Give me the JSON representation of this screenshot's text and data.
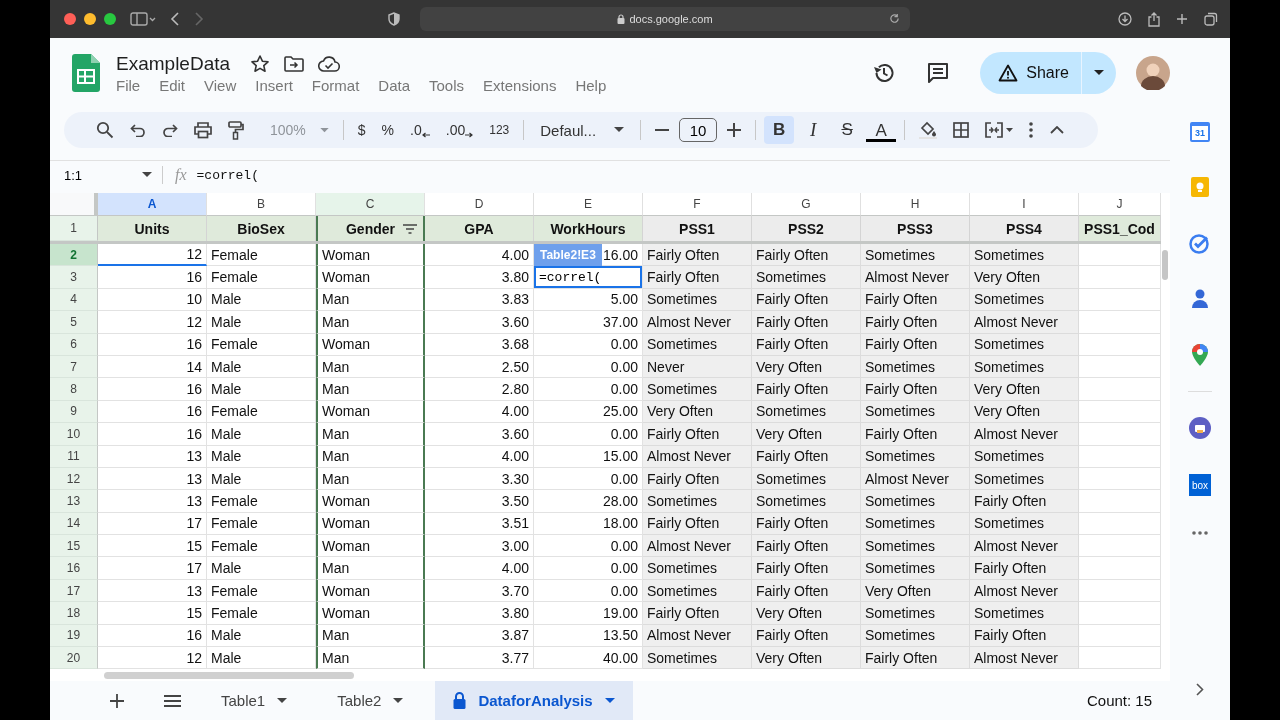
{
  "browser": {
    "url": "docs.google.com"
  },
  "doc": {
    "title": "ExampleData",
    "menus": [
      "File",
      "Edit",
      "View",
      "Insert",
      "Format",
      "Data",
      "Tools",
      "Extensions",
      "Help"
    ],
    "share": "Share"
  },
  "toolbar": {
    "zoom": {
      "label": "100%",
      "disabled": true
    },
    "currency": "$",
    "percent": "%",
    "decrease_decimal": ".0",
    "increase_decimal": ".00",
    "number_format": "123",
    "font": "Defaul...",
    "font_size": "10",
    "bold": {
      "label": "B",
      "on": true
    },
    "italic": {
      "label": "I",
      "on": false
    },
    "strikethrough": {
      "label": "S",
      "on": false
    },
    "text_color": {
      "label": "A"
    }
  },
  "formula_bar": {
    "cell_ref": "1:1",
    "fx": "fx",
    "formula": "=correl("
  },
  "grid": {
    "columns": [
      {
        "letter": "A",
        "header": "Units",
        "kind": "table",
        "selected": true,
        "filter": false
      },
      {
        "letter": "B",
        "header": "BioSex",
        "kind": "table",
        "selected": false,
        "filter": false
      },
      {
        "letter": "C",
        "header": "Gender",
        "kind": "table",
        "selected": false,
        "filter": true
      },
      {
        "letter": "D",
        "header": "GPA",
        "kind": "table",
        "selected": false,
        "filter": false
      },
      {
        "letter": "E",
        "header": "WorkHours",
        "kind": "table",
        "selected": false,
        "filter": false
      },
      {
        "letter": "F",
        "header": "PSS1",
        "kind": "grey",
        "selected": false,
        "filter": false
      },
      {
        "letter": "G",
        "header": "PSS2",
        "kind": "grey",
        "selected": false,
        "filter": false
      },
      {
        "letter": "H",
        "header": "PSS3",
        "kind": "grey",
        "selected": false,
        "filter": false
      },
      {
        "letter": "I",
        "header": "PSS4",
        "kind": "grey",
        "selected": false,
        "filter": false
      },
      {
        "letter": "J",
        "header": "PSS1_Cod",
        "kind": "table",
        "selected": false,
        "filter": false
      }
    ],
    "header_row_number": "1",
    "rows": [
      {
        "number": "2",
        "selected": true,
        "cells": [
          "12",
          "Female",
          "Woman",
          "4.00",
          "16.00",
          "Fairly Often",
          "Fairly Often",
          "Sometimes",
          "Sometimes"
        ]
      },
      {
        "number": "3",
        "selected": false,
        "cells": [
          "16",
          "Female",
          "Woman",
          "3.80",
          {
            "kind": "editor",
            "value": "=correl(",
            "tag": "Table2!E3"
          },
          "Fairly Often",
          "Sometimes",
          "Almost Never",
          "Very Often"
        ]
      },
      {
        "number": "4",
        "selected": false,
        "cells": [
          "10",
          "Male",
          "Man",
          "3.83",
          "5.00",
          "Sometimes",
          "Fairly Often",
          "Fairly Often",
          "Sometimes"
        ]
      },
      {
        "number": "5",
        "selected": false,
        "cells": [
          "12",
          "Male",
          "Man",
          "3.60",
          "37.00",
          "Almost Never",
          "Fairly Often",
          "Fairly Often",
          "Almost Never"
        ]
      },
      {
        "number": "6",
        "selected": false,
        "cells": [
          "16",
          "Female",
          "Woman",
          "3.68",
          "0.00",
          "Sometimes",
          "Fairly Often",
          "Fairly Often",
          "Sometimes"
        ]
      },
      {
        "number": "7",
        "selected": false,
        "cells": [
          "14",
          "Male",
          "Man",
          "2.50",
          "0.00",
          "Never",
          "Very Often",
          "Sometimes",
          "Sometimes"
        ]
      },
      {
        "number": "8",
        "selected": false,
        "cells": [
          "16",
          "Male",
          "Man",
          "2.80",
          "0.00",
          "Sometimes",
          "Fairly Often",
          "Fairly Often",
          "Very Often"
        ]
      },
      {
        "number": "9",
        "selected": false,
        "cells": [
          "16",
          "Female",
          "Woman",
          "4.00",
          "25.00",
          "Very Often",
          "Sometimes",
          "Sometimes",
          "Very Often"
        ]
      },
      {
        "number": "10",
        "selected": false,
        "cells": [
          "16",
          "Male",
          "Man",
          "3.60",
          "0.00",
          "Fairly Often",
          "Very Often",
          "Fairly Often",
          "Almost Never"
        ]
      },
      {
        "number": "11",
        "selected": false,
        "cells": [
          "13",
          "Male",
          "Man",
          "4.00",
          "15.00",
          "Almost Never",
          "Fairly Often",
          "Sometimes",
          "Sometimes"
        ]
      },
      {
        "number": "12",
        "selected": false,
        "cells": [
          "13",
          "Male",
          "Man",
          "3.30",
          "0.00",
          "Fairly Often",
          "Sometimes",
          "Almost Never",
          "Sometimes"
        ]
      },
      {
        "number": "13",
        "selected": false,
        "cells": [
          "13",
          "Female",
          "Woman",
          "3.50",
          "28.00",
          "Sometimes",
          "Sometimes",
          "Sometimes",
          "Fairly Often"
        ]
      },
      {
        "number": "14",
        "selected": false,
        "cells": [
          "17",
          "Female",
          "Woman",
          "3.51",
          "18.00",
          "Fairly Often",
          "Fairly Often",
          "Sometimes",
          "Sometimes"
        ]
      },
      {
        "number": "15",
        "selected": false,
        "cells": [
          "15",
          "Female",
          "Woman",
          "3.00",
          "0.00",
          "Almost Never",
          "Fairly Often",
          "Sometimes",
          "Almost Never"
        ]
      },
      {
        "number": "16",
        "selected": false,
        "cells": [
          "17",
          "Male",
          "Man",
          "4.00",
          "0.00",
          "Sometimes",
          "Fairly Often",
          "Sometimes",
          "Fairly Often"
        ]
      },
      {
        "number": "17",
        "selected": false,
        "cells": [
          "13",
          "Female",
          "Woman",
          "3.70",
          "0.00",
          "Sometimes",
          "Fairly Often",
          "Very Often",
          "Almost Never"
        ]
      },
      {
        "number": "18",
        "selected": false,
        "cells": [
          "15",
          "Female",
          "Woman",
          "3.80",
          "19.00",
          "Fairly Often",
          "Very Often",
          "Sometimes",
          "Sometimes"
        ]
      },
      {
        "number": "19",
        "selected": false,
        "cells": [
          "16",
          "Male",
          "Man",
          "3.87",
          "13.50",
          "Almost Never",
          "Fairly Often",
          "Sometimes",
          "Fairly Often"
        ]
      },
      {
        "number": "20",
        "selected": false,
        "cells": [
          "12",
          "Male",
          "Man",
          "3.77",
          "40.00",
          "Sometimes",
          "Very Often",
          "Fairly Often",
          "Almost Never"
        ]
      }
    ]
  },
  "side_panel": {
    "calendar_day": "31",
    "box_label": "box"
  },
  "sheet_tabs": [
    {
      "label": "Table1",
      "selected": false,
      "locked": false
    },
    {
      "label": "Table2",
      "selected": false,
      "locked": false
    },
    {
      "label": "DataforAnalysis",
      "selected": true,
      "locked": true
    }
  ],
  "status": {
    "count": "Count: 15"
  }
}
